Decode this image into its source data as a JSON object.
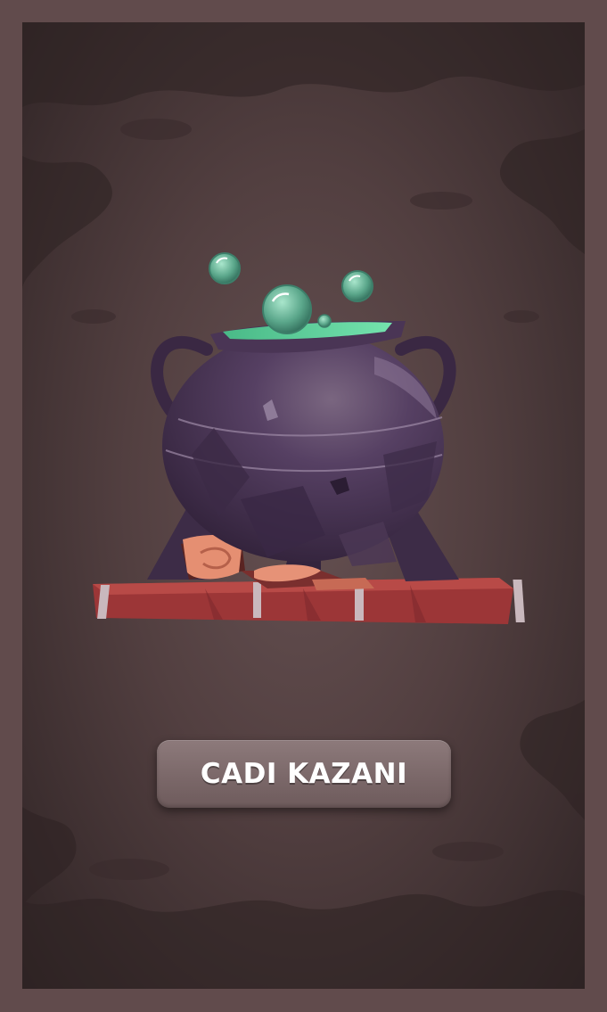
{
  "scene": {
    "object": "cauldron-icon",
    "title_button": {
      "label": "CADI KAZANI"
    }
  },
  "colors": {
    "frame": "#614b4c",
    "background_dark": "#2f2425",
    "cauldron": "#4a3550",
    "potion": "#5fd39b",
    "rug": "#a8393b",
    "button": "#7e6b6c",
    "button_text": "#ffffff"
  }
}
